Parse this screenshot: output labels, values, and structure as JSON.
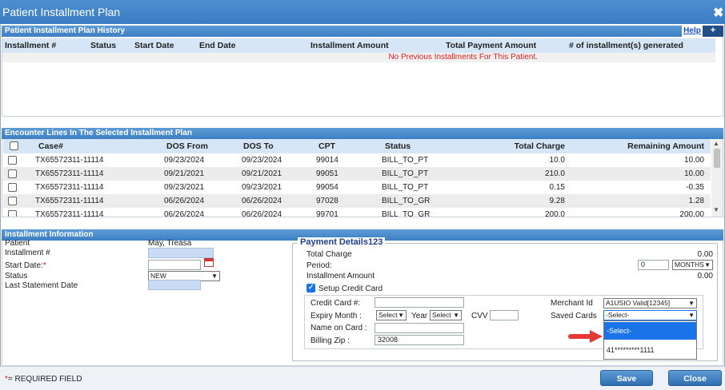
{
  "window": {
    "title": "Patient Installment Plan"
  },
  "history": {
    "section_title": "Patient Installment Plan History",
    "help_link": "Help",
    "add_label": "+",
    "columns": [
      "Installment #",
      "Status",
      "Start Date",
      "End Date",
      "Installment Amount",
      "Total Payment Amount",
      "# of installment(s) generated"
    ],
    "empty_message": "No Previous Installments For This Patient."
  },
  "encounters": {
    "section_title": "Encounter Lines In The Selected Installment Plan",
    "columns": [
      "Case#",
      "DOS From",
      "DOS To",
      "CPT",
      "Status",
      "Total Charge",
      "Remaining Amount"
    ],
    "rows": [
      [
        "TX65572311-11114",
        "09/23/2024",
        "09/23/2024",
        "99014",
        "BILL_TO_PT",
        "10.0",
        "10.00"
      ],
      [
        "TX65572311-11114",
        "09/21/2021",
        "09/21/2021",
        "99051",
        "BILL_TO_PT",
        "210.0",
        "10.00"
      ],
      [
        "TX65572311-11114",
        "09/23/2021",
        "09/23/2021",
        "99054",
        "BILL_TO_PT",
        "0.15",
        "-0.35"
      ],
      [
        "TX65572311-11114",
        "06/26/2024",
        "06/26/2024",
        "97028",
        "BILL_TO_GR",
        "9.28",
        "1.28"
      ],
      [
        "TX65572311-11114",
        "06/26/2024",
        "06/26/2024",
        "99701",
        "BILL_TO_GR",
        "200.0",
        "200.00"
      ]
    ]
  },
  "installment": {
    "section_title": "Installment Information",
    "patient_label": "Patient",
    "patient_value": "May, Treasa",
    "installment_no_label": "Installment #",
    "start_date_label": "Start Date:",
    "required_mark": "*",
    "status_label": "Status",
    "status_value": "NEW",
    "last_statement_label": "Last Statement Date"
  },
  "payment": {
    "legend": "Payment Details123",
    "total_charge_label": "Total Charge",
    "total_charge_value": "0.00",
    "period_label": "Period:",
    "period_value": "0",
    "period_unit": "MONTHS",
    "installment_amount_label": "Installment Amount",
    "installment_amount_value": "0.00",
    "setup_cc_label": "Setup Credit Card",
    "cc_number_label": "Credit Card #:",
    "expiry_label": "Expiry Month :",
    "expiry_value": "Select",
    "year_label": "Year",
    "year_value": "Select",
    "cvv_label": "CVV",
    "name_label": "Name on Card :",
    "zip_label": "Billing Zip :",
    "zip_value": "32008",
    "merchant_label": "Merchant Id",
    "merchant_value": "A1USIO Valid[12345]",
    "saved_cards_label": "Saved Cards",
    "saved_cards_value": "-Select-",
    "saved_cards_options": [
      "-Select-",
      "41*********1111"
    ]
  },
  "footer": {
    "required_mark": "*",
    "required_note": "= REQUIRED FIELD",
    "save_label": "Save",
    "close_label": "Close"
  },
  "colors": {
    "accent": "#3a7cc2",
    "header_row": "#d6e6f7",
    "error_text": "#e02020",
    "highlight": "#1a73e8",
    "arrow": "#e53935"
  }
}
